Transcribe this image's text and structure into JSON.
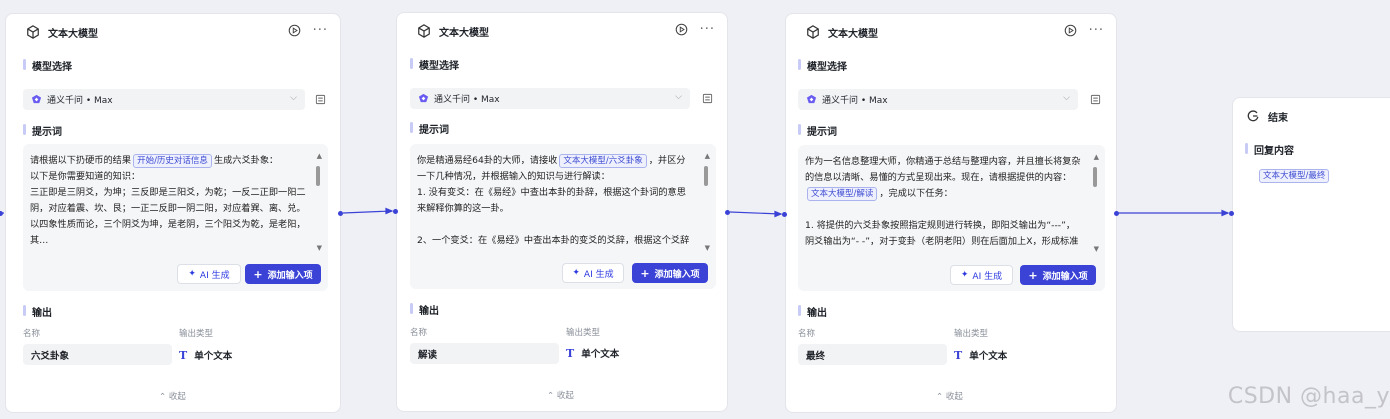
{
  "nodes": [
    {
      "title": "文本大模型",
      "model_label": "模型选择",
      "model": "通义千问 • Max",
      "prompt_label": "提示词",
      "prompt_before": "请根据以下扔硬币的结果",
      "prompt_tag": "开始/历史对话信息",
      "prompt_after": "生成六爻卦象：\n以下是你需要知道的知识：\n三正即是三阴爻，为坤；三反即是三阳爻，为乾；一反二正即一阳二阴，对应着震、坎、艮；一正二反即一阴二阳，对应着巽、离、兑。以四象性质而论，三个阴爻为坤，是老阴，三个阳爻为乾，是老阳，其…",
      "ai_btn": "AI 生成",
      "add_btn": "添加输入项",
      "output_label": "输出",
      "name_col": "名称",
      "type_col": "输出类型",
      "output_name": "六爻卦象",
      "output_type": "单个文本",
      "collapse": "收起"
    },
    {
      "title": "文本大模型",
      "model_label": "模型选择",
      "model": "通义千问 • Max",
      "prompt_label": "提示词",
      "prompt_before": "你是精通易经64卦的大师，请接收",
      "prompt_tag": "文本大模型/六爻卦象",
      "prompt_after": "，并区分一下几种情况，并根据输入的知识与进行解读：\n1. 没有变爻：在《易经》中查出本卦的卦辞，根据这个卦词的意思来解释你算的这一卦。\n\n2、一个变爻：在《易经》中查出本卦的变爻的爻辞，根据这个爻辞的意思来解释你算的这一卦。",
      "ai_btn": "AI 生成",
      "add_btn": "添加输入项",
      "output_label": "输出",
      "name_col": "名称",
      "type_col": "输出类型",
      "output_name": "解读",
      "output_type": "单个文本",
      "collapse": "收起"
    },
    {
      "title": "文本大模型",
      "model_label": "模型选择",
      "model": "通义千问 • Max",
      "prompt_label": "提示词",
      "prompt_before": "作为一名信息整理大师，你精通于总结与整理内容，并且擅长将复杂的信息以清晰、易懂的方式呈现出来。现在，请根据提供的内容：",
      "prompt_tag": "文本大模型/解读",
      "prompt_after": "，完成以下任务：\n\n1. 将提供的六爻卦象按照指定规则进行转换，即阳爻输出为“---”，阴爻输出为“- -”，对于变卦（老阴老阳）则在后面加上X，形成标准的六爻卦象。注意保证卦象的整齐…",
      "ai_btn": "AI 生成",
      "add_btn": "添加输入项",
      "output_label": "输出",
      "name_col": "名称",
      "type_col": "输出类型",
      "output_name": "最终",
      "output_type": "单个文本",
      "collapse": "收起"
    }
  ],
  "end_node": {
    "title": "结束",
    "reply_label": "回复内容",
    "reply_tag": "文本大模型/最终"
  },
  "watermark": "CSDN @haa_y",
  "colors": {
    "accent": "#3b42d6",
    "tag_border": "#aab3ee",
    "canvas": "#eef0f5"
  },
  "icons": [
    "cube-icon",
    "play-icon",
    "more-icon",
    "qwen-logo-icon",
    "chevron-down-icon",
    "settings-icon",
    "sparkle-icon",
    "plus-icon",
    "text-type-icon",
    "end-icon"
  ]
}
